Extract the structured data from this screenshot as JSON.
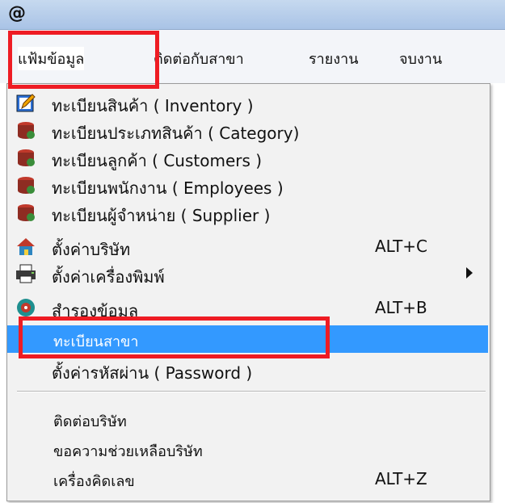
{
  "app": {
    "icon_glyph": "@"
  },
  "menubar": {
    "items": [
      {
        "label": "แฟ้มข้อมูล"
      },
      {
        "label": "ติดต่อกับสาขา"
      },
      {
        "label": "รายงาน"
      },
      {
        "label": "จบงาน"
      }
    ]
  },
  "menu": {
    "items": [
      {
        "label": "ทะเบียนสินค้า ( Inventory )",
        "icon": "edit-icon"
      },
      {
        "label": "ทะเบียนประเภทสินค้า ( Category)",
        "icon": "database-icon"
      },
      {
        "label": "ทะเบียนลูกค้า ( Customers )",
        "icon": "database-icon"
      },
      {
        "label": "ทะเบียนพนักงาน ( Employees )",
        "icon": "database-icon"
      },
      {
        "label": "ทะเบียนผู้จำหน่าย ( Supplier )",
        "icon": "database-icon"
      },
      {
        "label": "ตั้งค่าบริษัท",
        "icon": "house-icon",
        "shortcut": "ALT+C"
      },
      {
        "label": "ตั้งค่าเครื่องพิมพ์",
        "icon": "printer-icon"
      },
      {
        "label": "สำรองข้อมูล",
        "icon": "backup-icon",
        "shortcut": "ALT+B"
      },
      {
        "label": "ทะเบียนสาขา"
      },
      {
        "label": "ตั้งค่ารหัสผ่าน ( Password )"
      },
      {
        "label": "ติดต่อบริษัท"
      },
      {
        "label": "ขอความช่วยเหลือบริษัท"
      },
      {
        "label": "เครื่องคิดเลข",
        "shortcut": "ALT+Z"
      }
    ]
  },
  "colors": {
    "highlight": "#3399ff",
    "annotation": "#ee1c24"
  }
}
